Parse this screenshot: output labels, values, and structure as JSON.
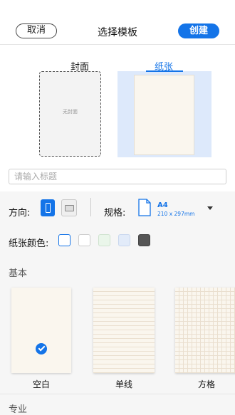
{
  "header": {
    "cancel_label": "取消",
    "title": "选择模板",
    "create_label": "创建"
  },
  "preview": {
    "cover_tab": "封面",
    "cover_placeholder": "无封面",
    "paper_tab": "纸张"
  },
  "title_input": {
    "placeholder": "请输入标题"
  },
  "orientation": {
    "label": "方向:",
    "selected": "portrait"
  },
  "size": {
    "label": "规格:",
    "name": "A4",
    "dimensions": "210 x 297mm"
  },
  "paper_color": {
    "label": "纸张颜色:",
    "swatches": [
      "#ffffff",
      "#ffffff",
      "#eaf6ea",
      "#e2ebf9",
      "#555555"
    ],
    "selected_index": 0,
    "accent": "#1474e8"
  },
  "sections": {
    "basic": {
      "title": "基本",
      "templates": [
        {
          "label": "空白",
          "selected": true
        },
        {
          "label": "单线",
          "selected": false
        },
        {
          "label": "方格",
          "selected": false
        }
      ]
    },
    "pro": {
      "title": "专业"
    }
  }
}
